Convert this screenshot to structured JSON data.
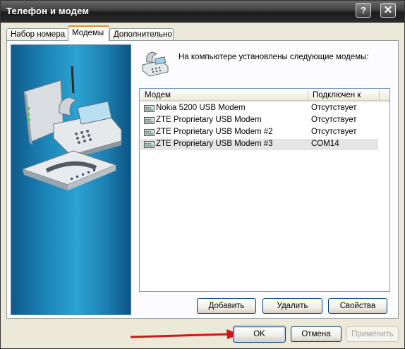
{
  "window": {
    "title": "Телефон и модем",
    "help_label": "?",
    "close_label": "✕"
  },
  "tabs": [
    {
      "label": "Набор номера"
    },
    {
      "label": "Модемы"
    },
    {
      "label": "Дополнительно"
    }
  ],
  "intro_text": "На компьютере установлены следующие модемы:",
  "table": {
    "columns": [
      "Модем",
      "Подключен к"
    ],
    "rows": [
      {
        "name": "Nokia 5200 USB Modem",
        "port": "Отсутствует"
      },
      {
        "name": "ZTE Proprietary USB Modem",
        "port": "Отсутствует"
      },
      {
        "name": "ZTE Proprietary USB Modem #2",
        "port": "Отсутствует"
      },
      {
        "name": "ZTE Proprietary USB Modem #3",
        "port": "COM14"
      }
    ]
  },
  "panel_buttons": {
    "add": "Добавить",
    "remove": "Удалить",
    "properties": "Свойства"
  },
  "dialog_buttons": {
    "ok": "OK",
    "cancel": "Отмена",
    "apply": "Применить"
  },
  "icons": {
    "header": "phone-modem-icon",
    "row": "modem-icon",
    "annotation": "red-arrow"
  },
  "colors": {
    "title_bar": "#2a2a2a",
    "tab_highlight": "#e68b2c",
    "art_blue": "#1d86b8",
    "annotation": "#d01818"
  }
}
